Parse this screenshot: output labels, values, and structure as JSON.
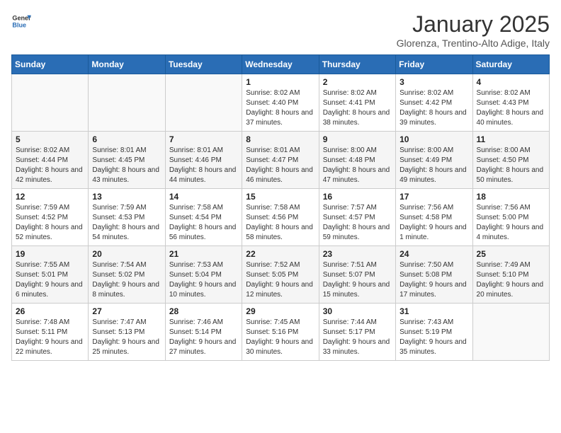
{
  "header": {
    "logo_line1": "General",
    "logo_line2": "Blue",
    "month": "January 2025",
    "location": "Glorenza, Trentino-Alto Adige, Italy"
  },
  "days_of_week": [
    "Sunday",
    "Monday",
    "Tuesday",
    "Wednesday",
    "Thursday",
    "Friday",
    "Saturday"
  ],
  "weeks": [
    [
      {
        "day": "",
        "detail": ""
      },
      {
        "day": "",
        "detail": ""
      },
      {
        "day": "",
        "detail": ""
      },
      {
        "day": "1",
        "detail": "Sunrise: 8:02 AM\nSunset: 4:40 PM\nDaylight: 8 hours and 37 minutes."
      },
      {
        "day": "2",
        "detail": "Sunrise: 8:02 AM\nSunset: 4:41 PM\nDaylight: 8 hours and 38 minutes."
      },
      {
        "day": "3",
        "detail": "Sunrise: 8:02 AM\nSunset: 4:42 PM\nDaylight: 8 hours and 39 minutes."
      },
      {
        "day": "4",
        "detail": "Sunrise: 8:02 AM\nSunset: 4:43 PM\nDaylight: 8 hours and 40 minutes."
      }
    ],
    [
      {
        "day": "5",
        "detail": "Sunrise: 8:02 AM\nSunset: 4:44 PM\nDaylight: 8 hours and 42 minutes."
      },
      {
        "day": "6",
        "detail": "Sunrise: 8:01 AM\nSunset: 4:45 PM\nDaylight: 8 hours and 43 minutes."
      },
      {
        "day": "7",
        "detail": "Sunrise: 8:01 AM\nSunset: 4:46 PM\nDaylight: 8 hours and 44 minutes."
      },
      {
        "day": "8",
        "detail": "Sunrise: 8:01 AM\nSunset: 4:47 PM\nDaylight: 8 hours and 46 minutes."
      },
      {
        "day": "9",
        "detail": "Sunrise: 8:00 AM\nSunset: 4:48 PM\nDaylight: 8 hours and 47 minutes."
      },
      {
        "day": "10",
        "detail": "Sunrise: 8:00 AM\nSunset: 4:49 PM\nDaylight: 8 hours and 49 minutes."
      },
      {
        "day": "11",
        "detail": "Sunrise: 8:00 AM\nSunset: 4:50 PM\nDaylight: 8 hours and 50 minutes."
      }
    ],
    [
      {
        "day": "12",
        "detail": "Sunrise: 7:59 AM\nSunset: 4:52 PM\nDaylight: 8 hours and 52 minutes."
      },
      {
        "day": "13",
        "detail": "Sunrise: 7:59 AM\nSunset: 4:53 PM\nDaylight: 8 hours and 54 minutes."
      },
      {
        "day": "14",
        "detail": "Sunrise: 7:58 AM\nSunset: 4:54 PM\nDaylight: 8 hours and 56 minutes."
      },
      {
        "day": "15",
        "detail": "Sunrise: 7:58 AM\nSunset: 4:56 PM\nDaylight: 8 hours and 58 minutes."
      },
      {
        "day": "16",
        "detail": "Sunrise: 7:57 AM\nSunset: 4:57 PM\nDaylight: 8 hours and 59 minutes."
      },
      {
        "day": "17",
        "detail": "Sunrise: 7:56 AM\nSunset: 4:58 PM\nDaylight: 9 hours and 1 minute."
      },
      {
        "day": "18",
        "detail": "Sunrise: 7:56 AM\nSunset: 5:00 PM\nDaylight: 9 hours and 4 minutes."
      }
    ],
    [
      {
        "day": "19",
        "detail": "Sunrise: 7:55 AM\nSunset: 5:01 PM\nDaylight: 9 hours and 6 minutes."
      },
      {
        "day": "20",
        "detail": "Sunrise: 7:54 AM\nSunset: 5:02 PM\nDaylight: 9 hours and 8 minutes."
      },
      {
        "day": "21",
        "detail": "Sunrise: 7:53 AM\nSunset: 5:04 PM\nDaylight: 9 hours and 10 minutes."
      },
      {
        "day": "22",
        "detail": "Sunrise: 7:52 AM\nSunset: 5:05 PM\nDaylight: 9 hours and 12 minutes."
      },
      {
        "day": "23",
        "detail": "Sunrise: 7:51 AM\nSunset: 5:07 PM\nDaylight: 9 hours and 15 minutes."
      },
      {
        "day": "24",
        "detail": "Sunrise: 7:50 AM\nSunset: 5:08 PM\nDaylight: 9 hours and 17 minutes."
      },
      {
        "day": "25",
        "detail": "Sunrise: 7:49 AM\nSunset: 5:10 PM\nDaylight: 9 hours and 20 minutes."
      }
    ],
    [
      {
        "day": "26",
        "detail": "Sunrise: 7:48 AM\nSunset: 5:11 PM\nDaylight: 9 hours and 22 minutes."
      },
      {
        "day": "27",
        "detail": "Sunrise: 7:47 AM\nSunset: 5:13 PM\nDaylight: 9 hours and 25 minutes."
      },
      {
        "day": "28",
        "detail": "Sunrise: 7:46 AM\nSunset: 5:14 PM\nDaylight: 9 hours and 27 minutes."
      },
      {
        "day": "29",
        "detail": "Sunrise: 7:45 AM\nSunset: 5:16 PM\nDaylight: 9 hours and 30 minutes."
      },
      {
        "day": "30",
        "detail": "Sunrise: 7:44 AM\nSunset: 5:17 PM\nDaylight: 9 hours and 33 minutes."
      },
      {
        "day": "31",
        "detail": "Sunrise: 7:43 AM\nSunset: 5:19 PM\nDaylight: 9 hours and 35 minutes."
      },
      {
        "day": "",
        "detail": ""
      }
    ]
  ]
}
